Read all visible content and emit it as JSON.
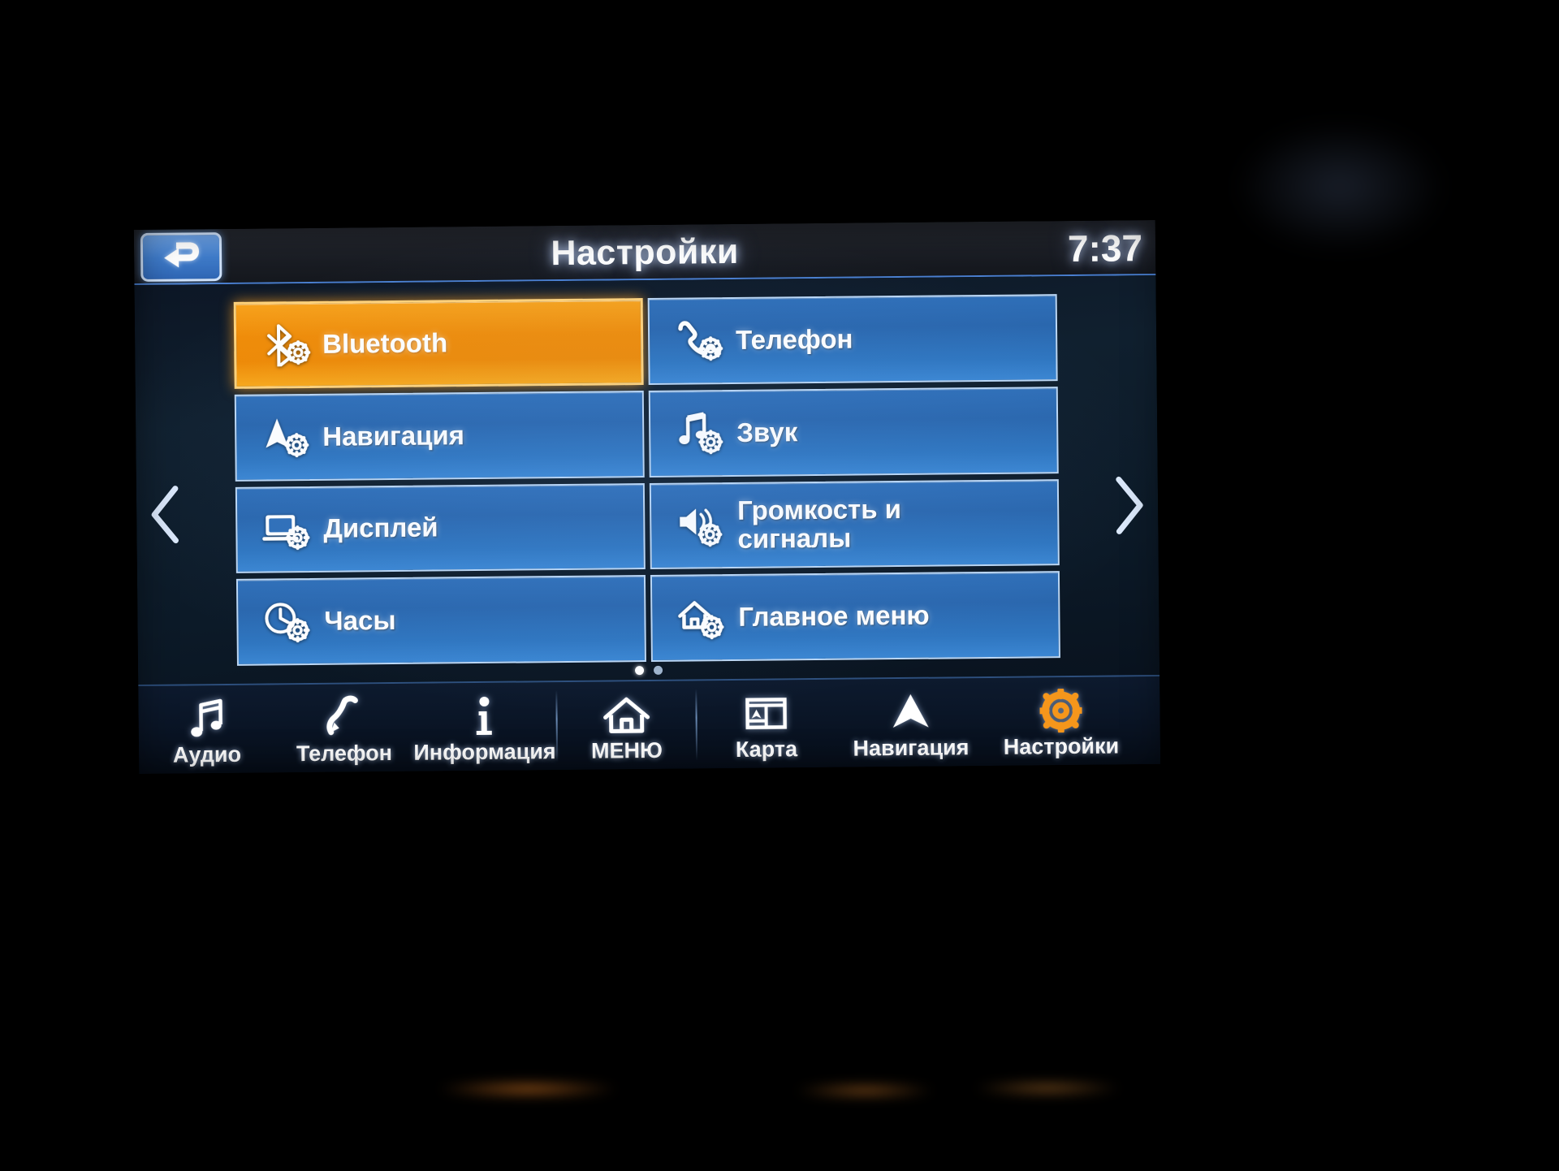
{
  "header": {
    "back_icon": "back-arrow-icon",
    "title": "Настройки",
    "time": "7:37"
  },
  "nav_arrows": {
    "prev_icon": "chevron-left-icon",
    "next_icon": "chevron-right-icon"
  },
  "grid": {
    "tiles": [
      {
        "label": "Bluetooth",
        "icon": "bluetooth-gear-icon",
        "selected": true
      },
      {
        "label": "Телефон",
        "icon": "phone-gear-icon",
        "selected": false
      },
      {
        "label": "Навигация",
        "icon": "navigation-gear-icon",
        "selected": false
      },
      {
        "label": "Звук",
        "icon": "sound-gear-icon",
        "selected": false
      },
      {
        "label": "Дисплей",
        "icon": "display-gear-icon",
        "selected": false
      },
      {
        "label": "Громкость и\nсигналы",
        "icon": "volume-gear-icon",
        "selected": false
      },
      {
        "label": "Часы",
        "icon": "clock-gear-icon",
        "selected": false
      },
      {
        "label": "Главное меню",
        "icon": "home-gear-icon",
        "selected": false
      }
    ]
  },
  "pagination": {
    "total_pages": 2,
    "current_page": 1
  },
  "bottom_nav": {
    "items": [
      {
        "label": "Аудио",
        "icon": "music-note-icon",
        "active": false
      },
      {
        "label": "Телефон",
        "icon": "phone-handset-icon",
        "active": false
      },
      {
        "label": "Информация",
        "icon": "info-icon",
        "active": false
      },
      {
        "label": "МЕНЮ",
        "icon": "home-icon",
        "active": false
      },
      {
        "label": "Карта",
        "icon": "map-icon",
        "active": false
      },
      {
        "label": "Навигация",
        "icon": "nav-arrow-icon",
        "active": false
      },
      {
        "label": "Настройки",
        "icon": "gear-icon",
        "active": true
      }
    ]
  },
  "colors": {
    "accent_orange": "#f19109",
    "tile_blue": "#2f6fb8",
    "tile_border": "#bcd8f6",
    "screen_bg": "#0d1726",
    "text": "#ffffff"
  }
}
